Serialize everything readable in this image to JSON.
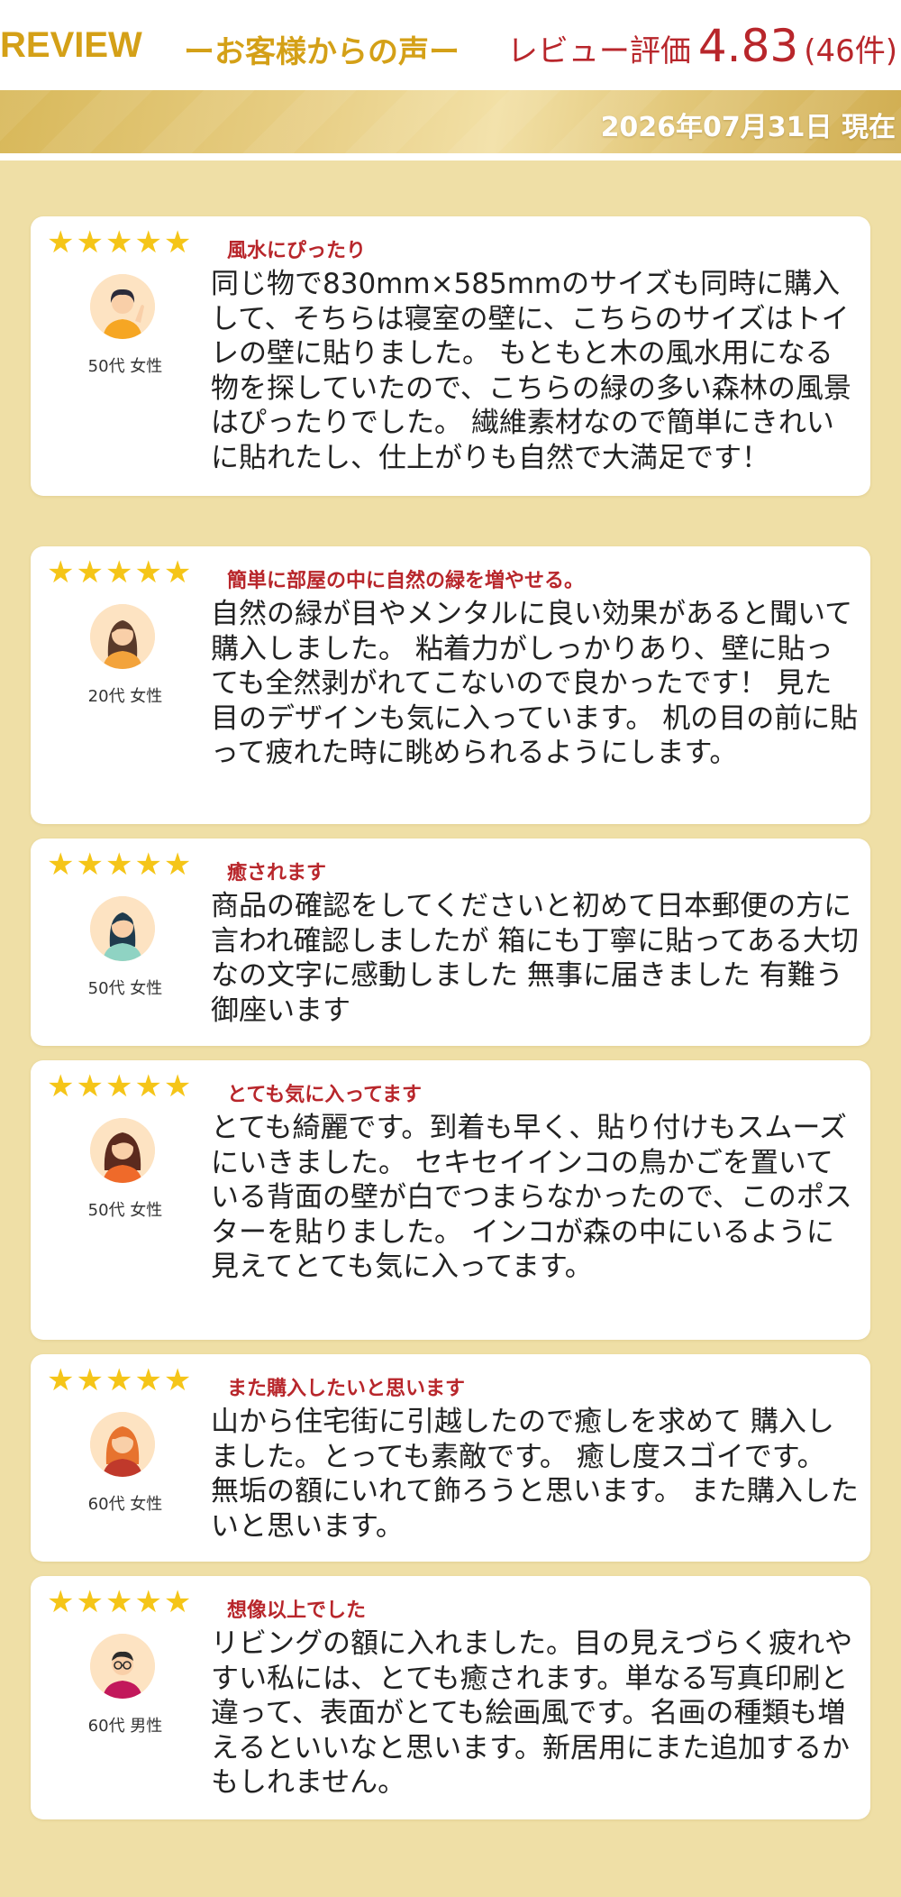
{
  "header": {
    "review_en": "REVIEW",
    "review_jp": "ーお客様からの声ー",
    "rating_label": "レビュー評価",
    "rating_value": "4.83",
    "rating_count": "(46件)",
    "date": "2026年07月31日 現在"
  },
  "colors": {
    "gold": "#d4a017",
    "red": "#b8262b",
    "background": "#efdfa6",
    "star": "#f5c518"
  },
  "reviews": [
    {
      "stars": "★★★★★",
      "rating": 5,
      "title": "風水にぴったり",
      "age": "50代 女性",
      "avatar": "woman-waving-icon",
      "body": "同じ物で830mm×585mmのサイズも同時に購入して、そちらは寝室の壁に、こちらのサイズはトイレの壁に貼りました。 もともと木の風水用になる物を探していたので、こちらの緑の多い森林の風景はぴったりでした。 繊維素材なので簡単にきれいに貼れたし、仕上がりも自然で大満足です！"
    },
    {
      "stars": "★★★★★",
      "rating": 5,
      "title": "簡単に部屋の中に自然の緑を増やせる。",
      "age": "20代 女性",
      "avatar": "woman-long-hair-icon",
      "body": "自然の緑が目やメンタルに良い効果があると聞いて購入しました。 粘着力がしっかりあり、壁に貼っても全然剥がれてこないので良かったです！ 見た目のデザインも気に入っています。 机の目の前に貼って疲れた時に眺められるようにします。"
    },
    {
      "stars": "★★★★★",
      "rating": 5,
      "title": "癒されます",
      "age": "50代 女性",
      "avatar": "woman-teal-icon",
      "body": "商品の確認をしてくださいと初めて日本郵便の方に言われ確認しましたが 箱にも丁寧に貼ってある大切なの文字に感動しました 無事に届きました 有難う御座います"
    },
    {
      "stars": "★★★★★",
      "rating": 5,
      "title": "とても気に入ってます",
      "age": "50代 女性",
      "avatar": "woman-orange-icon",
      "body": "とても綺麗です。到着も早く、貼り付けもスムーズにいきました。 セキセイインコの鳥かごを置いている背面の壁が白でつまらなかったので、このポスターを貼りました。 インコが森の中にいるように見えてとても気に入ってます。"
    },
    {
      "stars": "★★★★★",
      "rating": 5,
      "title": "また購入したいと思います",
      "age": "60代 女性",
      "avatar": "woman-red-hair-icon",
      "body": "山から住宅街に引越したので癒しを求めて 購入しました。とっても素敵です。 癒し度スゴイです。 無垢の額にいれて飾ろうと思います。 また購入したいと思います。"
    },
    {
      "stars": "★★★★★",
      "rating": 5,
      "title": "想像以上でした",
      "age": "60代 男性",
      "avatar": "man-glasses-icon",
      "body": "リビングの額に入れました。目の見えづらく疲れやすい私には、とても癒されます。単なる写真印刷と違って、表面がとても絵画風です。名画の種類も増えるといいなと思います。新居用にまた追加するかもしれません。"
    }
  ]
}
